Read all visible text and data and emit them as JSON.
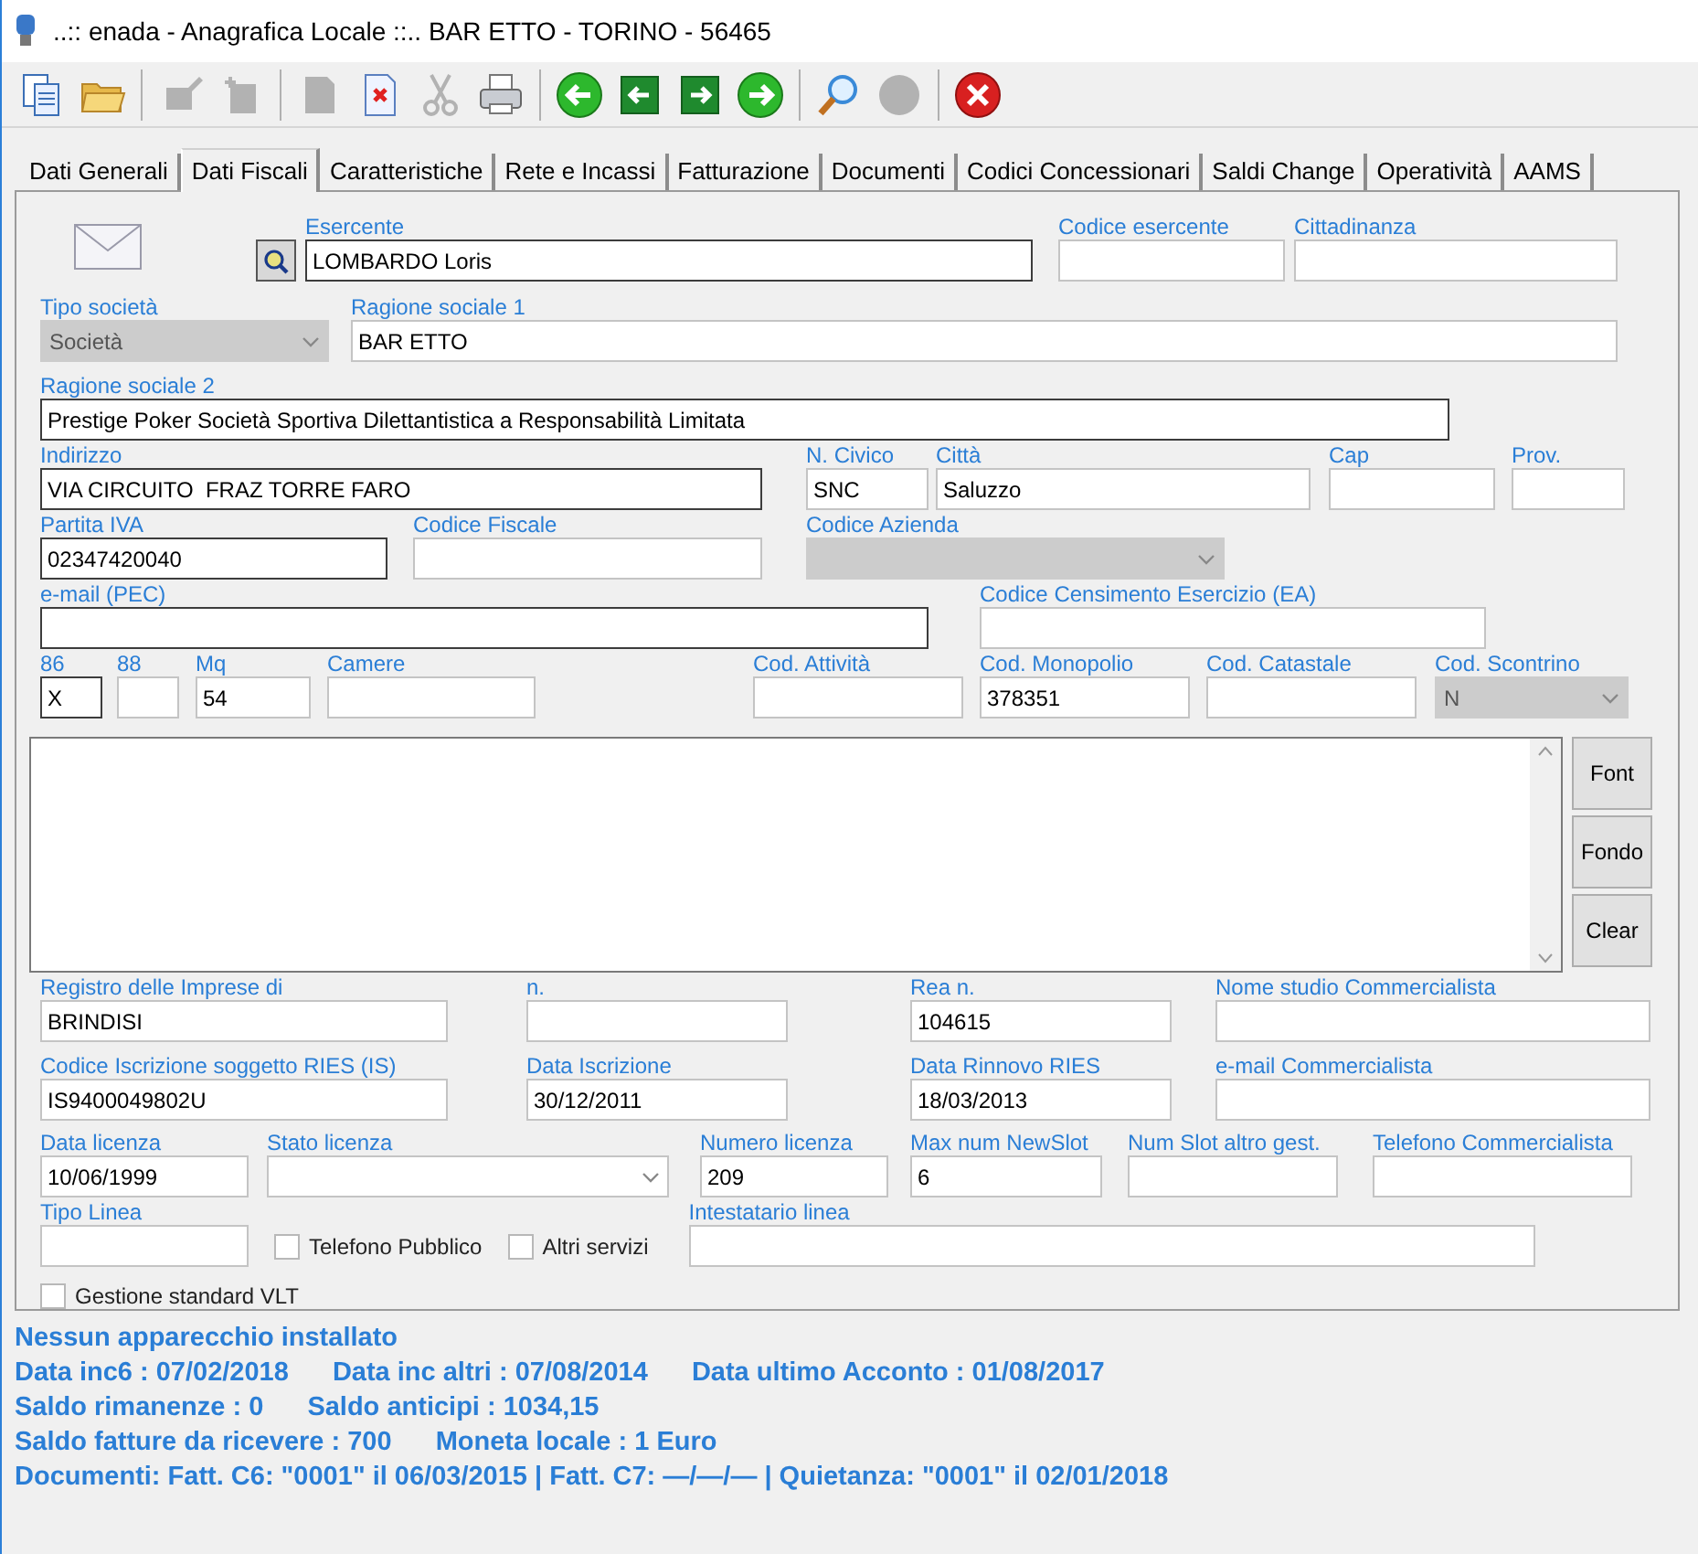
{
  "window": {
    "title": "..:: enada - Anagrafica Locale ::.. BAR ETTO - TORINO - 56465"
  },
  "toolbar": [
    {
      "kind": "copy",
      "disabled": false
    },
    {
      "kind": "folder",
      "disabled": false
    },
    {
      "kind": "sep"
    },
    {
      "kind": "edit",
      "disabled": true
    },
    {
      "kind": "add",
      "disabled": true
    },
    {
      "kind": "sep"
    },
    {
      "kind": "save",
      "disabled": true
    },
    {
      "kind": "delete",
      "disabled": false
    },
    {
      "kind": "cut",
      "disabled": true
    },
    {
      "kind": "print",
      "disabled": false
    },
    {
      "kind": "sep"
    },
    {
      "kind": "first",
      "disabled": false
    },
    {
      "kind": "prev",
      "disabled": false
    },
    {
      "kind": "next",
      "disabled": false
    },
    {
      "kind": "last",
      "disabled": false
    },
    {
      "kind": "sep"
    },
    {
      "kind": "search",
      "disabled": false
    },
    {
      "kind": "dot",
      "disabled": true
    },
    {
      "kind": "sep"
    },
    {
      "kind": "close",
      "disabled": false
    }
  ],
  "tabs": [
    {
      "label": "Dati Generali",
      "selected": false
    },
    {
      "label": "Dati Fiscali",
      "selected": true
    },
    {
      "label": "Caratteristiche",
      "selected": false
    },
    {
      "label": "Rete e Incassi",
      "selected": false
    },
    {
      "label": "Fatturazione",
      "selected": false
    },
    {
      "label": "Documenti",
      "selected": false
    },
    {
      "label": "Codici Concessionari",
      "selected": false
    },
    {
      "label": "Saldi Change",
      "selected": false
    },
    {
      "label": "Operatività",
      "selected": false
    },
    {
      "label": "AAMS",
      "selected": false
    }
  ],
  "rows": [
    {
      "fields": [
        {
          "kind": "text",
          "label": "Esercente",
          "value": "LOMBARDO Loris",
          "required": true
        },
        {
          "kind": "text",
          "label": "Codice esercente",
          "required": false
        },
        {
          "kind": "text",
          "label": "Cittadinanza",
          "required": false
        }
      ]
    },
    {
      "fields": [
        {
          "kind": "combo",
          "label": "Tipo società",
          "value": "Società",
          "disabled": true
        },
        {
          "kind": "text",
          "label": "Ragione sociale 1",
          "value": "BAR ETTO",
          "required": false
        }
      ]
    },
    {
      "fields": [
        {
          "kind": "text",
          "label": "Ragione sociale 2",
          "value": "Prestige Poker Società Sportiva Dilettantistica a Responsabilità Limitata",
          "required": true
        }
      ]
    },
    {
      "fields": [
        {
          "kind": "text",
          "label": "Indirizzo",
          "value": "VIA CIRCUITO  FRAZ TORRE FARO",
          "required": true
        },
        {
          "kind": "text",
          "label": "N. Civico",
          "value": "SNC",
          "required": false
        },
        {
          "kind": "text",
          "label": "Città",
          "value": "Saluzzo",
          "required": false
        },
        {
          "kind": "text",
          "label": "Cap",
          "required": false
        },
        {
          "kind": "text",
          "label": "Prov.",
          "required": false
        }
      ]
    },
    {
      "fields": [
        {
          "kind": "text",
          "label": "Partita IVA",
          "value": "02347420040",
          "required": true
        },
        {
          "kind": "text",
          "label": "Codice Fiscale",
          "required": false
        },
        {
          "kind": "combo",
          "label": "Codice Azienda",
          "disabled": true
        }
      ]
    },
    {
      "fields": [
        {
          "kind": "text",
          "label": "e-mail (PEC)",
          "required": true
        },
        {
          "kind": "text",
          "label": "Codice Censimento Esercizio (EA)",
          "required": false
        }
      ]
    },
    {
      "fields": [
        {
          "kind": "text",
          "label": "86",
          "value": "X",
          "required": true
        },
        {
          "kind": "text",
          "label": "88",
          "required": false
        },
        {
          "kind": "text",
          "label": "Mq",
          "value": "54",
          "required": false
        },
        {
          "kind": "text",
          "label": "Camere",
          "required": false
        },
        {
          "kind": "text",
          "label": "Cod. Attività",
          "required": false
        },
        {
          "kind": "text",
          "label": "Cod. Monopolio",
          "value": "378351",
          "required": false
        },
        {
          "kind": "text",
          "label": "Cod. Catastale",
          "required": false
        },
        {
          "kind": "combo",
          "label": "Cod. Scontrino",
          "value": "N",
          "disabled": true
        }
      ]
    },
    {
      "fields": [
        {
          "kind": "text",
          "label": "Registro delle Imprese di",
          "value": "BRINDISI",
          "required": false
        },
        {
          "kind": "text",
          "label": "n.",
          "required": false
        },
        {
          "kind": "text",
          "label": "Rea n.",
          "value": "104615",
          "required": false
        },
        {
          "kind": "text",
          "label": "Nome studio Commercialista",
          "required": false
        }
      ]
    },
    {
      "fields": [
        {
          "kind": "text",
          "label": "Codice Iscrizione soggetto RIES (IS)",
          "value": "IS9400049802U",
          "required": false
        },
        {
          "kind": "text",
          "label": "Data Iscrizione",
          "value": "30/12/2011",
          "required": false
        },
        {
          "kind": "text",
          "label": "Data Rinnovo RIES",
          "value": "18/03/2013",
          "required": false
        },
        {
          "kind": "text",
          "label": "e-mail Commercialista",
          "required": false
        }
      ]
    },
    {
      "fields": [
        {
          "kind": "text",
          "label": "Data licenza",
          "value": "10/06/1999",
          "required": false
        },
        {
          "kind": "combo",
          "label": "Stato licenza",
          "disabled": false
        },
        {
          "kind": "text",
          "label": "Numero licenza",
          "value": "209",
          "required": false
        },
        {
          "kind": "text",
          "label": "Max num NewSlot",
          "value": "6",
          "required": false
        },
        {
          "kind": "text",
          "label": "Num Slot altro gest.",
          "required": false
        },
        {
          "kind": "text",
          "label": "Telefono Commercialista",
          "required": false
        }
      ]
    },
    {
      "fields": [
        {
          "kind": "text",
          "label": "Tipo Linea",
          "required": false
        },
        {
          "kind": "check",
          "label": "Telefono Pubblico",
          "checked": false
        },
        {
          "kind": "check",
          "label": "Altri servizi",
          "checked": false
        },
        {
          "kind": "text",
          "label": "Intestatario linea",
          "required": false
        }
      ]
    },
    {
      "fields": [
        {
          "kind": "check",
          "label": "Gestione standard VLT",
          "checked": false
        }
      ]
    }
  ],
  "memo_buttons": [
    "Font",
    "Fondo",
    "Clear"
  ],
  "status_lines": [
    [
      "Nessun apparecchio installato"
    ],
    [
      "Data inc6 : 07/02/2018",
      "Data inc altri : 07/08/2014",
      "Data ultimo Acconto : 01/08/2017"
    ],
    [
      "Saldo rimanenze : 0",
      "Saldo anticipi : 1034,15"
    ],
    [
      "Saldo fatture da ricevere : 700",
      "Moneta locale : 1 Euro"
    ],
    [
      "Documenti: Fatt. C6: \"0001\" il 06/03/2015 | Fatt. C7: —/—/— | Quietanza: \"0001\" il 02/01/2018"
    ]
  ]
}
